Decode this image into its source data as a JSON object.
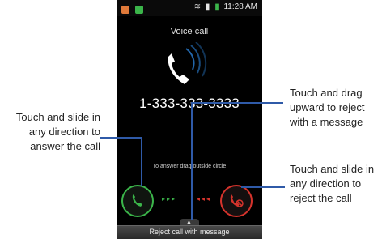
{
  "callouts": {
    "answer": "Touch and slide in any direction to answer the call",
    "reject_message": "Touch and drag upward to reject with a message",
    "reject": "Touch and slide in any direction to reject the call"
  },
  "status_bar": {
    "time": "11:28 AM",
    "icons": [
      "notification-icon",
      "missed-call-icon",
      "wifi-icon",
      "signal-icon",
      "battery-icon"
    ]
  },
  "call": {
    "title": "Voice call",
    "number": "1-333-333-3333",
    "hint": "To answer drag outside circle"
  },
  "bottom_bar": {
    "label": "Reject call with message"
  },
  "colors": {
    "answer": "#3bb54a",
    "reject": "#d5332c",
    "callout_line": "#2f5aa8"
  }
}
